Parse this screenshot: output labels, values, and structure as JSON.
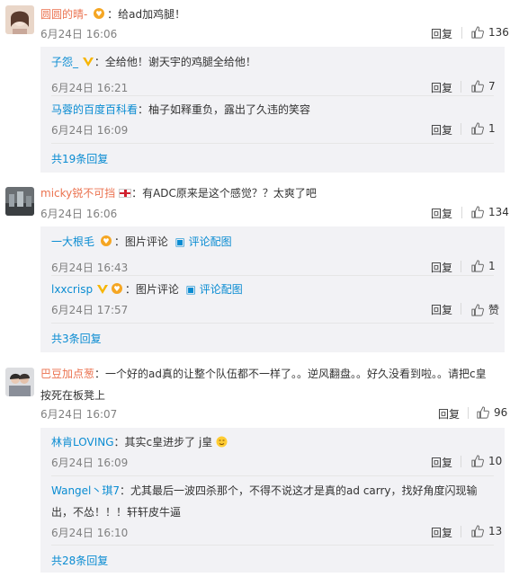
{
  "reply_label": "回复",
  "comments": [
    {
      "user": "圆圆的晴-",
      "text": "：给ad加鸡腿！",
      "time": "6月24日 16:06",
      "likes": "136",
      "subs": [
        {
          "user": "子怨_",
          "text": "：全给他！谢天宇的鸡腿全给他！",
          "time": "6月24日 16:21",
          "likes": "7"
        },
        {
          "user": "马蓉的百度百科看",
          "text": "：柚子如释重负，露出了久违的笑容",
          "time": "6月24日 16:09",
          "likes": "1"
        }
      ],
      "more": "共19条回复"
    },
    {
      "user": "micky锐不可挡",
      "text": "：有ADC原来是这个感觉？？太爽了吧",
      "time": "6月24日 16:06",
      "likes": "134",
      "subs": [
        {
          "user": "一大根毛",
          "text": "：图片评论",
          "pic": "评论配图",
          "time": "6月24日 16:43",
          "likes": "1"
        },
        {
          "user": "lxxcrisp",
          "text": "：图片评论",
          "pic": "评论配图",
          "time": "6月24日 17:57",
          "likes": "赞"
        }
      ],
      "more": "共3条回复"
    },
    {
      "user": "巴豆加点葱",
      "text": "：一个好的ad真的让整个队伍都不一样了。。逆风翻盘。。好久没看到啦。。请把c皇按死在板凳上",
      "time": "6月24日 16:07",
      "likes": "96",
      "subs": [
        {
          "user": "林肯LOVING",
          "text": "：其实c皇进步了 j皇",
          "time": "6月24日 16:09",
          "likes": "10"
        },
        {
          "user": "Wangel丶琪7",
          "text": "：尤其最后一波四杀那个，不得不说这才是真的ad carry，找好角度闪现输出，不怂！！！轩轩皮牛逼",
          "time": "6月24日 16:10",
          "likes": "13"
        }
      ],
      "more": "共28条回复"
    }
  ]
}
